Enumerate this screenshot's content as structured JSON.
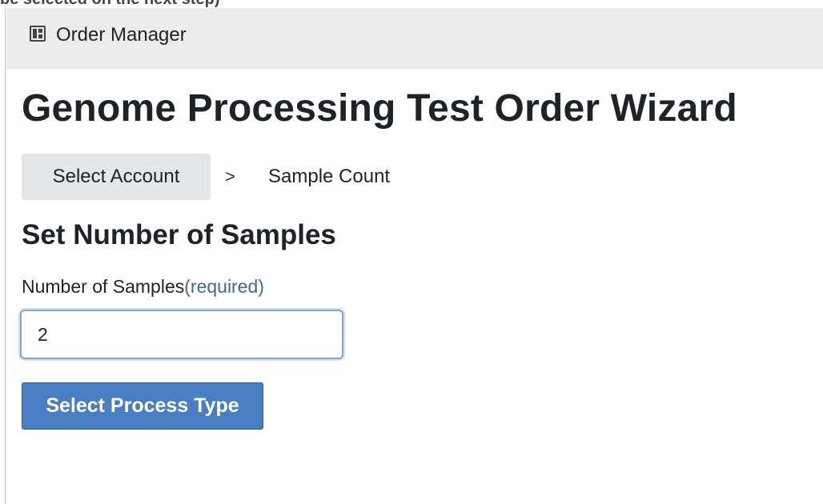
{
  "top_fragment": "be selected on the next step)",
  "app": {
    "icon": "layout-panels-icon",
    "title": "Order Manager"
  },
  "page": {
    "title": "Genome Processing Test Order Wizard"
  },
  "breadcrumb": {
    "items": [
      {
        "label": "Select Account"
      },
      {
        "label": "Sample Count"
      }
    ],
    "separator": ">"
  },
  "section": {
    "title": "Set Number of Samples"
  },
  "samples_field": {
    "label": "Number of Samples",
    "required_hint": "(required)",
    "value": "2"
  },
  "actions": {
    "next_label": "Select Process Type"
  },
  "colors": {
    "header_bg": "#ececec",
    "crumb_bg": "#e4e6e8",
    "required_text": "#3e6b9b",
    "input_focus_border": "#7fa7d1",
    "primary_button_bg": "#4a7ec2"
  }
}
